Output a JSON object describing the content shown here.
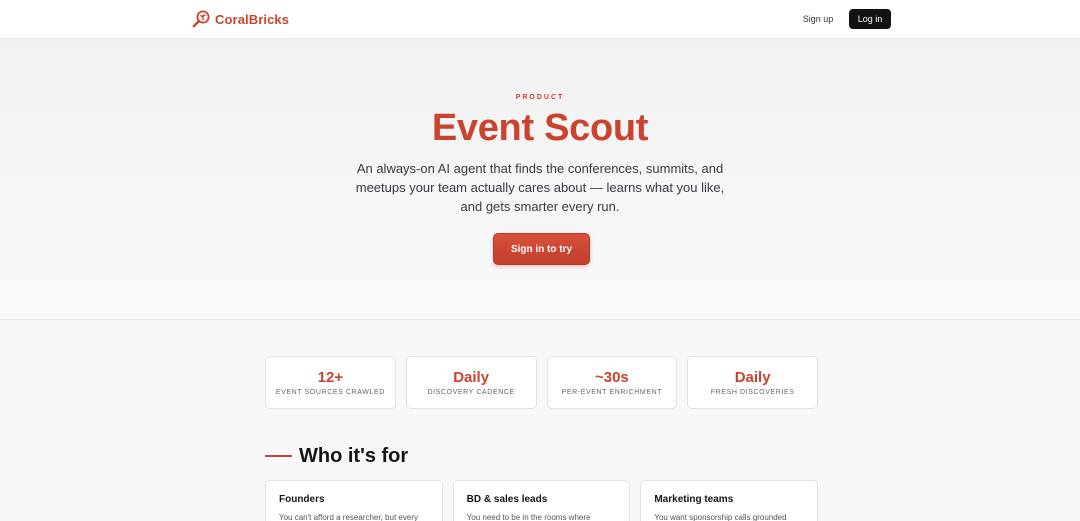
{
  "nav": {
    "brand": "CoralBricks",
    "signup_label": "Sign up",
    "login_label": "Log in"
  },
  "hero": {
    "eyebrow": "PRODUCT",
    "title": "Event Scout",
    "subtitle": "An always-on AI agent that finds the conferences, summits, and meetups your team actually cares about — learns what you like, and gets smarter every run.",
    "cta_label": "Sign in to try"
  },
  "stats": [
    {
      "value": "12+",
      "label": "EVENT SOURCES CRAWLED"
    },
    {
      "value": "Daily",
      "label": "DISCOVERY CADENCE"
    },
    {
      "value": "~30s",
      "label": "PER-EVENT ENRICHMENT"
    },
    {
      "value": "Daily",
      "label": "FRESH DISCOVERIES"
    }
  ],
  "audience": {
    "title": "Who it's for",
    "cards": [
      {
        "title": "Founders",
        "desc": "You can't afford a researcher, but every"
      },
      {
        "title": "BD & sales leads",
        "desc": "You need to be in the rooms where"
      },
      {
        "title": "Marketing teams",
        "desc": "You want sponsorship calls grounded"
      }
    ]
  },
  "colors": {
    "accent": "#c9432f",
    "login_bg": "#121212",
    "background": "#f8f8f8"
  },
  "icons": {
    "brand": "magnifier-coral-icon"
  }
}
